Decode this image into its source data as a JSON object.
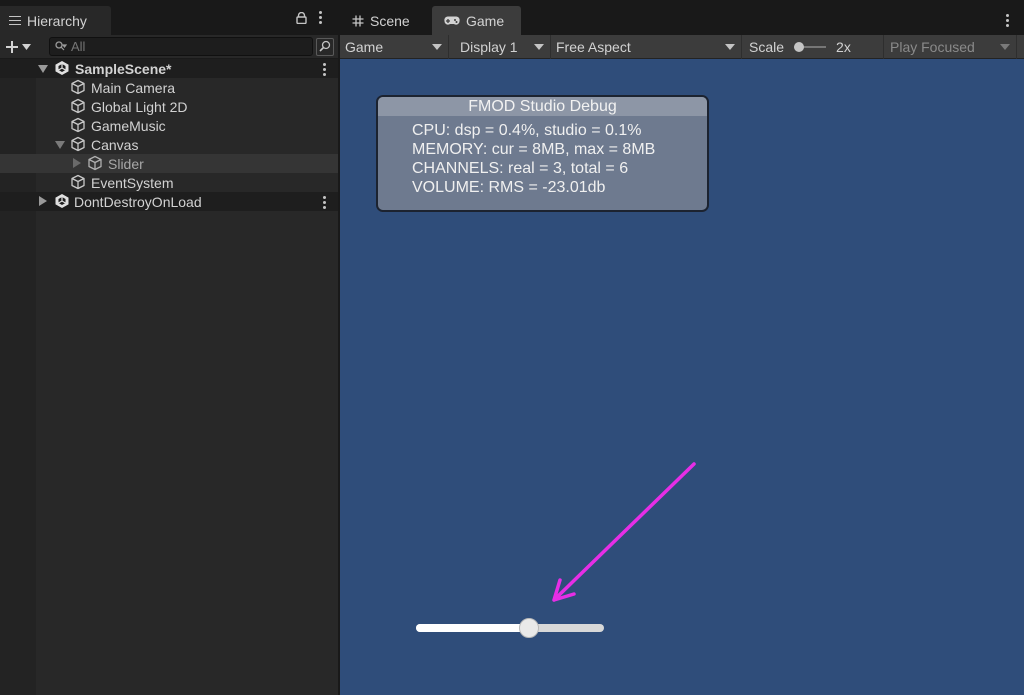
{
  "hierarchy": {
    "tab_label": "Hierarchy",
    "search_placeholder": "All",
    "items": [
      {
        "label": "SampleScene*"
      },
      {
        "label": "Main Camera"
      },
      {
        "label": "Global Light 2D"
      },
      {
        "label": "GameMusic"
      },
      {
        "label": "Canvas"
      },
      {
        "label": "Slider"
      },
      {
        "label": "EventSystem"
      },
      {
        "label": "DontDestroyOnLoad"
      }
    ]
  },
  "tabs": {
    "scene_label": "Scene",
    "game_label": "Game"
  },
  "game_toolbar": {
    "view_mode": "Game",
    "display": "Display 1",
    "aspect": "Free Aspect",
    "scale_label": "Scale",
    "scale_value": "2x",
    "play_mode": "Play Focused"
  },
  "debug": {
    "title": "FMOD Studio Debug",
    "lines": [
      "CPU: dsp = 0.4%, studio = 0.1%",
      "MEMORY: cur = 8MB, max = 8MB",
      "CHANNELS: real = 3, total = 6",
      "VOLUME: RMS = -23.01db"
    ]
  },
  "slider": {
    "value": 0.6
  },
  "colors": {
    "viewport_bg": "#2f4d7a",
    "annotation_arrow": "#e62ee6"
  }
}
